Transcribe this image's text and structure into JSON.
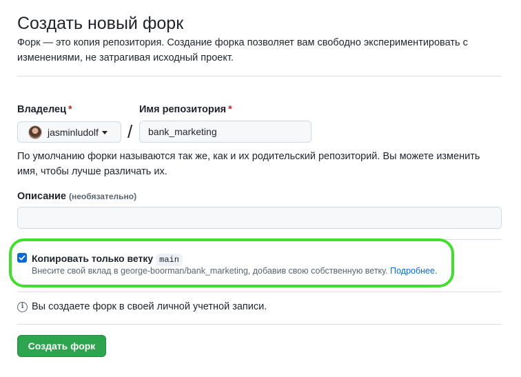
{
  "page": {
    "title": "Создать новый форк",
    "subtitle": "Форк — это копия репозитория. Создание форка позволяет вам свободно экспериментировать с изменениями, не затрагивая исходный проект."
  },
  "owner": {
    "label": "Владелец",
    "required_mark": "*",
    "value": "jasminludolf"
  },
  "repo": {
    "label": "Имя репозитория",
    "required_mark": "*",
    "value": "bank_marketing",
    "separator": "/"
  },
  "naming_help": "По умолчанию форки называются так же, как и их родительский репозиторий. Вы можете изменить имя, чтобы лучше различать их.",
  "description": {
    "label": "Описание",
    "optional_note": "(необязательно)",
    "value": ""
  },
  "copy_branch": {
    "checked": true,
    "label": "Копировать только ветку",
    "branch": "main",
    "note": "Внесите свой вклад в george-boorman/bank_marketing, добавив свою собственную ветку.",
    "link": "Подробнее."
  },
  "info": {
    "text": "Вы создаете форк в своей личной учетной записи."
  },
  "submit": {
    "label": "Создать форк"
  },
  "colors": {
    "accent_blue": "#0969da",
    "primary_green": "#2da44e",
    "highlight_green": "#3ee02a",
    "required_red": "#cf222e"
  },
  "icons": [
    "avatar",
    "chevron-down-icon",
    "checkmark-icon",
    "info-icon"
  ]
}
